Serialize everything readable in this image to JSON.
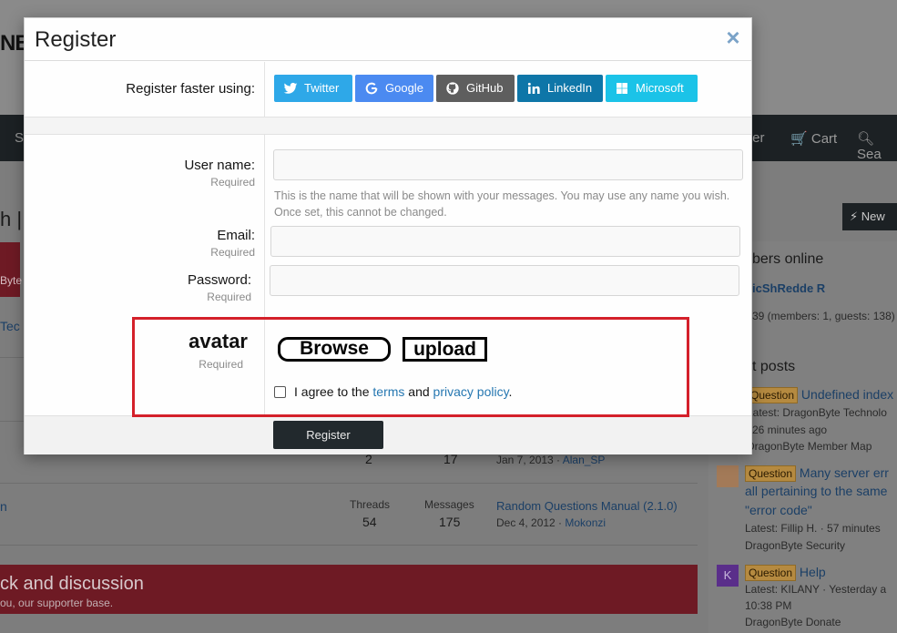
{
  "background": {
    "logo": "NB",
    "nav": {
      "item_s": "S",
      "register": "ter",
      "cart": "Cart",
      "search": "Sea"
    },
    "page_title_fragment": "h |",
    "new_button": "New",
    "members_online": {
      "title": "bers online",
      "member": "icShRedde R",
      "count": "39 (members: 1, guests: 138)"
    },
    "latest_posts_title": "t posts",
    "left_fragments": {
      "byte": "Byte",
      "tec": "Tec"
    },
    "forum_rows": [
      {
        "threads_value": "2",
        "messages_value": "17",
        "latest_date": "Jan 7, 2013",
        "latest_user": "Alan_SP"
      },
      {
        "name_fragment": "n",
        "threads_label": "Threads",
        "threads_value": "54",
        "messages_label": "Messages",
        "messages_value": "175",
        "latest_title": "Random Questions Manual (2.1.0)",
        "latest_date": "Dec 4, 2012",
        "latest_user": "Mokonzi"
      }
    ],
    "sidebar_posts": [
      {
        "badge": "Question",
        "title": "Undefined index",
        "meta": "Latest: DragonByte Technolo",
        "time": "26 minutes ago",
        "forum": "DragonByte Member Map"
      },
      {
        "badge": "Question",
        "title_lines": [
          "Many server err",
          "all pertaining to the same",
          "\"error code\""
        ],
        "meta": "Latest: Fillip H. · 57 minutes",
        "forum": "DragonByte Security"
      },
      {
        "badge": "Question",
        "title": "Help",
        "avatar_letter": "K",
        "meta": "Latest: KILANY · Yesterday a",
        "time": "10:38 PM",
        "forum": "DragonByte Donate"
      }
    ],
    "feedback": {
      "title": "ck and discussion",
      "subtitle": "ou, our supporter base."
    }
  },
  "modal": {
    "title": "Register",
    "close_icon": "×",
    "social": {
      "label": "Register faster using:",
      "buttons": [
        {
          "label": "Twitter",
          "color": "#2ea8e8"
        },
        {
          "label": "Google",
          "color": "#4b8af1"
        },
        {
          "label": "GitHub",
          "color": "#5e5e5e"
        },
        {
          "label": "LinkedIn",
          "color": "#0e76a8"
        },
        {
          "label": "Microsoft",
          "color": "#1bc3e8"
        }
      ]
    },
    "fields": {
      "username": {
        "label": "User name:",
        "required": "Required",
        "value": "",
        "hint": "This is the name that will be shown with your messages. You may use any name you wish. Once set, this cannot be changed."
      },
      "email": {
        "label": "Email:",
        "required": "Required",
        "value": ""
      },
      "password": {
        "label": "Password:",
        "required": "Required",
        "value": ""
      },
      "avatar": {
        "label": "avatar",
        "required": "Required",
        "browse": "Browse",
        "upload": "upload"
      }
    },
    "agree": {
      "prefix": "I agree to the",
      "terms": "terms",
      "and": "and",
      "privacy": "privacy policy",
      "suffix": "."
    },
    "submit": "Register",
    "highlight_color": "#d4202a"
  }
}
